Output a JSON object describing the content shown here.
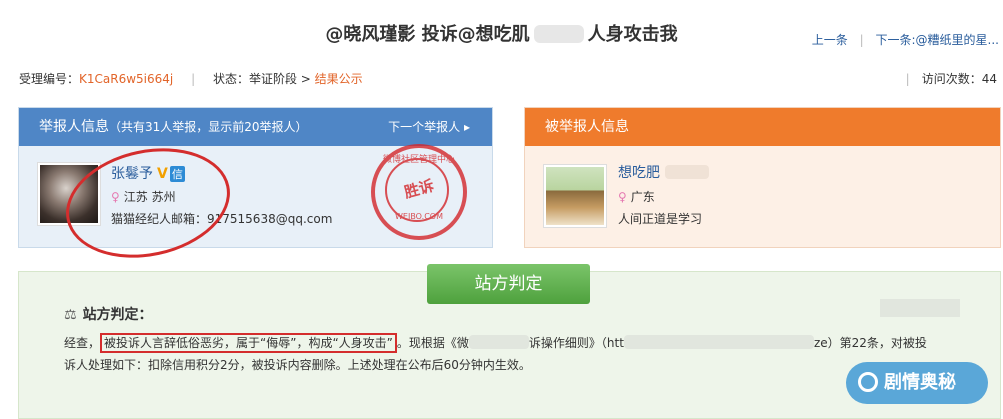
{
  "title": {
    "left": "@晓风瑾影 投诉@想吃肌",
    "right": "人身攻击我"
  },
  "nav": {
    "prev": "上一条",
    "sep": "|",
    "next": "下一条:@糟纸里的星..."
  },
  "meta": {
    "id_label": "受理编号：",
    "id_value": "K1CaR6w5i664j",
    "sep": "|",
    "status_label": "状态：举证阶段 >",
    "status_result": "结果公示",
    "visits_label": "访问次数：44"
  },
  "reporter": {
    "header_title": "举报人信息",
    "header_sub": "（共有31人举报，显示前20举报人）",
    "next_reporter": "下一个举报人 ▸",
    "name": "张鬈予",
    "verified_badge": "信",
    "location": "江苏 苏州",
    "email": "猫猫经纪人邮箱：917515638@qq.com",
    "stamp_ring": "微博社区管理中心",
    "stamp_center": "胜诉",
    "stamp_bottom": "WEIBO.COM"
  },
  "reported": {
    "header_title": "被举报人信息",
    "name": "想吃肥",
    "location": "广东",
    "bio": "人间正道是学习"
  },
  "judgment": {
    "tab": "站方判定",
    "heading": "站方判定：",
    "text_1": "经查，",
    "text_highlight": "被投诉人言辞低俗恶劣，属于“侮辱”，构成“人身攻击”",
    "text_2": "。现根据《微",
    "text_3": "诉操作细则》（htt",
    "text_4": "ze）第22条，对被投",
    "text_5": "诉人处理如下：扣除信用积分2分，被投诉内容删除。上述处理在公布后60分钟内生效。"
  },
  "watermark": "剧情奥秘"
}
